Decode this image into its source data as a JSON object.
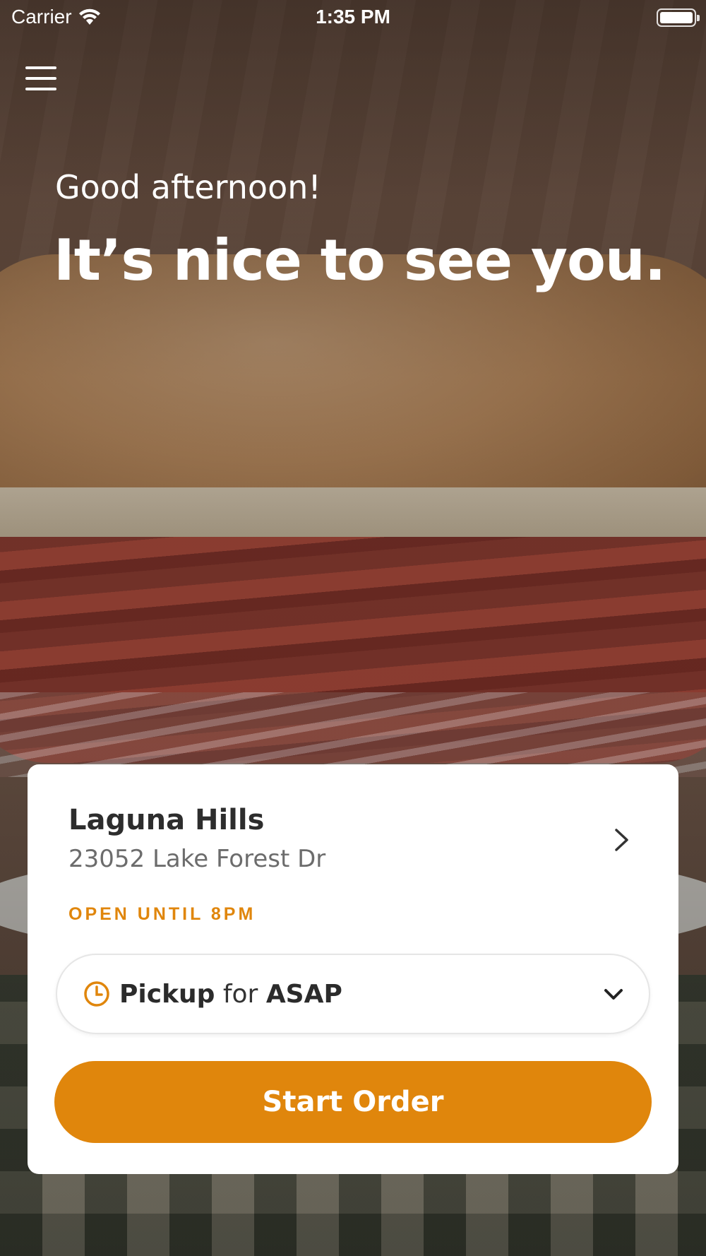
{
  "status_bar": {
    "carrier": "Carrier",
    "time": "1:35 PM"
  },
  "menu": {
    "icon": "hamburger-menu-icon"
  },
  "hero": {
    "greeting": "Good afternoon!",
    "headline": "It’s nice to see you."
  },
  "store": {
    "name": "Laguna Hills",
    "address": "23052 Lake Forest Dr",
    "hours": "OPEN UNTIL 8PM"
  },
  "order_mode": {
    "mode": "Pickup",
    "connector": "for",
    "time": "ASAP"
  },
  "actions": {
    "start_order": "Start Order"
  },
  "colors": {
    "accent": "#e0860c",
    "card": "#ffffff",
    "text_dark": "#2d2d2d",
    "text_muted": "#6c6c6c"
  }
}
